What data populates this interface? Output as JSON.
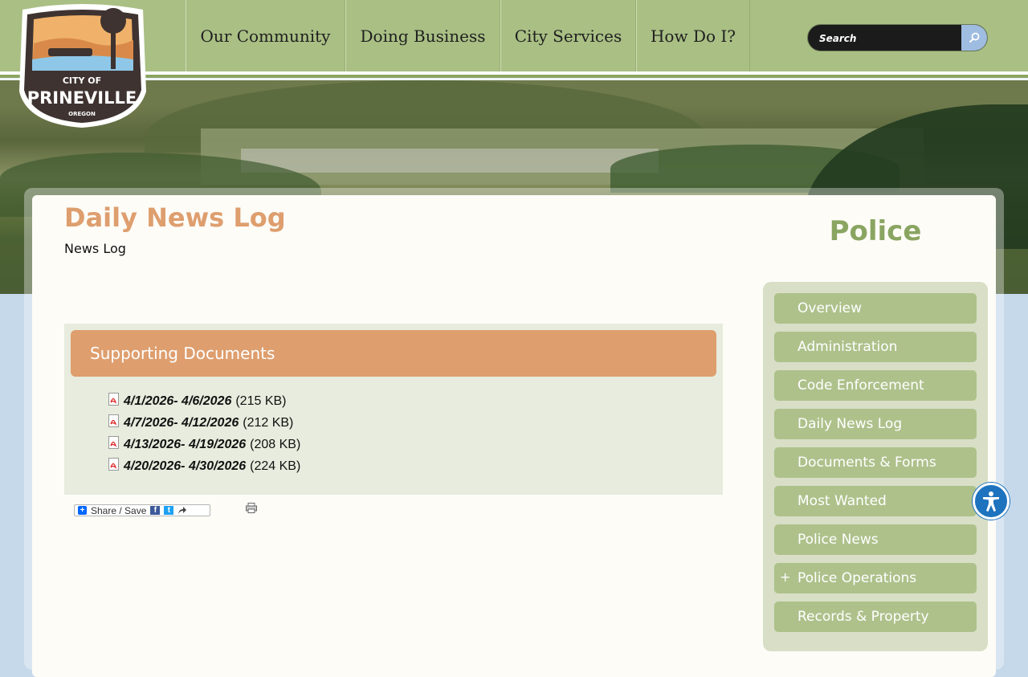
{
  "header": {
    "nav": [
      {
        "label": "Our Community"
      },
      {
        "label": "Doing Business"
      },
      {
        "label": "City Services"
      },
      {
        "label": "How Do I?"
      }
    ],
    "search": {
      "placeholder": "Search"
    },
    "logo": {
      "line1": "CITY OF",
      "line2": "PRINEVILLE",
      "line3": "OREGON"
    }
  },
  "main": {
    "title": "Daily News Log",
    "subtitle": "News Log",
    "documents": {
      "heading": "Supporting Documents",
      "items": [
        {
          "label": "4/1/2026- 4/6/2026",
          "size": "(215 KB)",
          "icon": "pdf-icon"
        },
        {
          "label": "4/7/2026- 4/12/2026",
          "size": "(212 KB)",
          "icon": "pdf-icon"
        },
        {
          "label": "4/13/2026- 4/19/2026",
          "size": "(208 KB)",
          "icon": "pdf-icon"
        },
        {
          "label": "4/20/2026- 4/30/2026",
          "size": "(224 KB)",
          "icon": "pdf-icon"
        }
      ]
    },
    "share": {
      "label": "Share / Save"
    }
  },
  "sidebar": {
    "title": "Police",
    "items": [
      {
        "label": "Overview"
      },
      {
        "label": "Administration"
      },
      {
        "label": "Code Enforcement"
      },
      {
        "label": "Daily News Log"
      },
      {
        "label": "Documents & Forms"
      },
      {
        "label": "Most Wanted"
      },
      {
        "label": "Police News"
      },
      {
        "label": "Police Operations",
        "expand": "+"
      },
      {
        "label": "Records & Property"
      }
    ]
  },
  "colors": {
    "header_green": "#a9bf84",
    "title_orange": "#de9e6e",
    "sidebar_item": "#aec18b",
    "sidebar_title": "#8aa561",
    "accessibility_blue": "#1e73be"
  }
}
